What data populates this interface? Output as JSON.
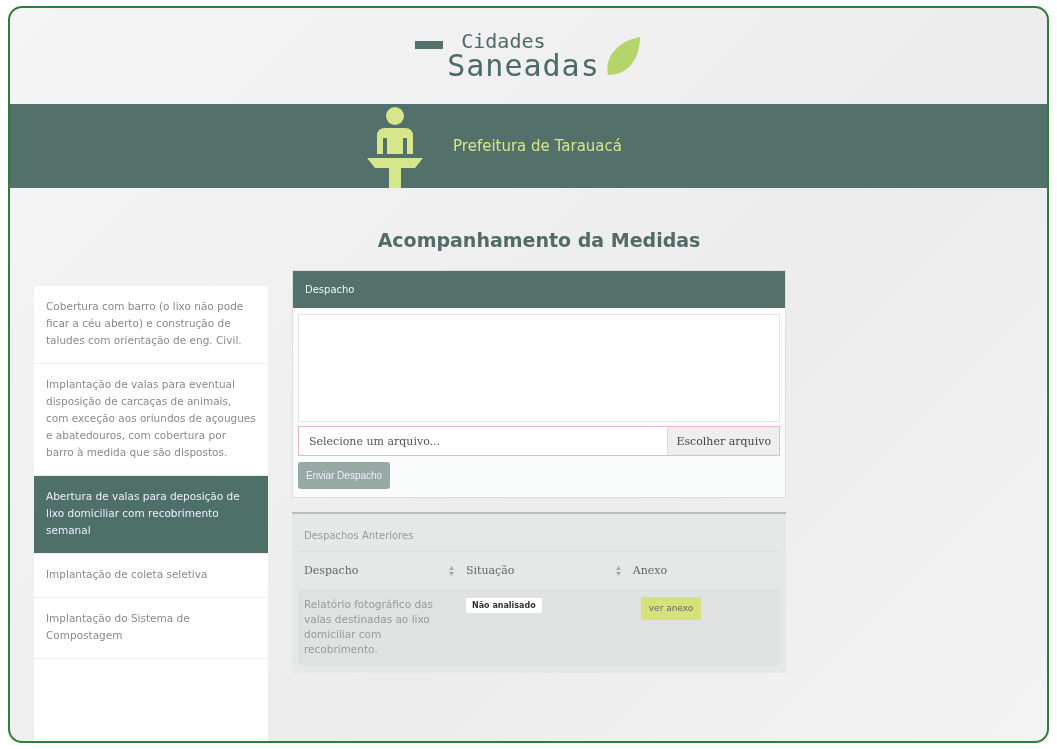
{
  "logo": {
    "line_1": "Cidades",
    "line_2": "Saneadas"
  },
  "banner": {
    "title": "Prefeitura de Tarauacá"
  },
  "page_title": "Acompanhamento da Medidas",
  "sidebar": {
    "items": [
      {
        "label": "Cobertura com barro (o lixo não pode ficar a céu aberto) e construção de taludes com orientação de eng. Civil.",
        "selected": false
      },
      {
        "label": "Implantação de valas para eventual disposição de carcaças de animais, com exceção aos oriundos de açougues e abatedouros, com cobertura por barro à medida que são dispostos.",
        "selected": false
      },
      {
        "label": "Abertura de valas para deposição de lixo domiciliar com recobrimento semanal",
        "selected": true
      },
      {
        "label": "Implantação de coleta seletiva",
        "selected": false
      },
      {
        "label": "Implantação do Sistema de Compostagem",
        "selected": false
      }
    ]
  },
  "despacho_form": {
    "header": "Despacho",
    "file_placeholder": "Selecione um arquivo...",
    "file_button": "Escolher arquivo",
    "submit": "Enviar Despacho",
    "submit_disabled": true
  },
  "previous": {
    "header": "Despachos Anteriores",
    "columns": [
      "Despacho",
      "Situação",
      "Anexo"
    ],
    "rows": [
      {
        "despacho": "Relatório fotográfico das valas destinadas ao lixo domiciliar com recobrimento.",
        "situacao": "Não analisado",
        "anexo": "ver anexo"
      }
    ]
  }
}
